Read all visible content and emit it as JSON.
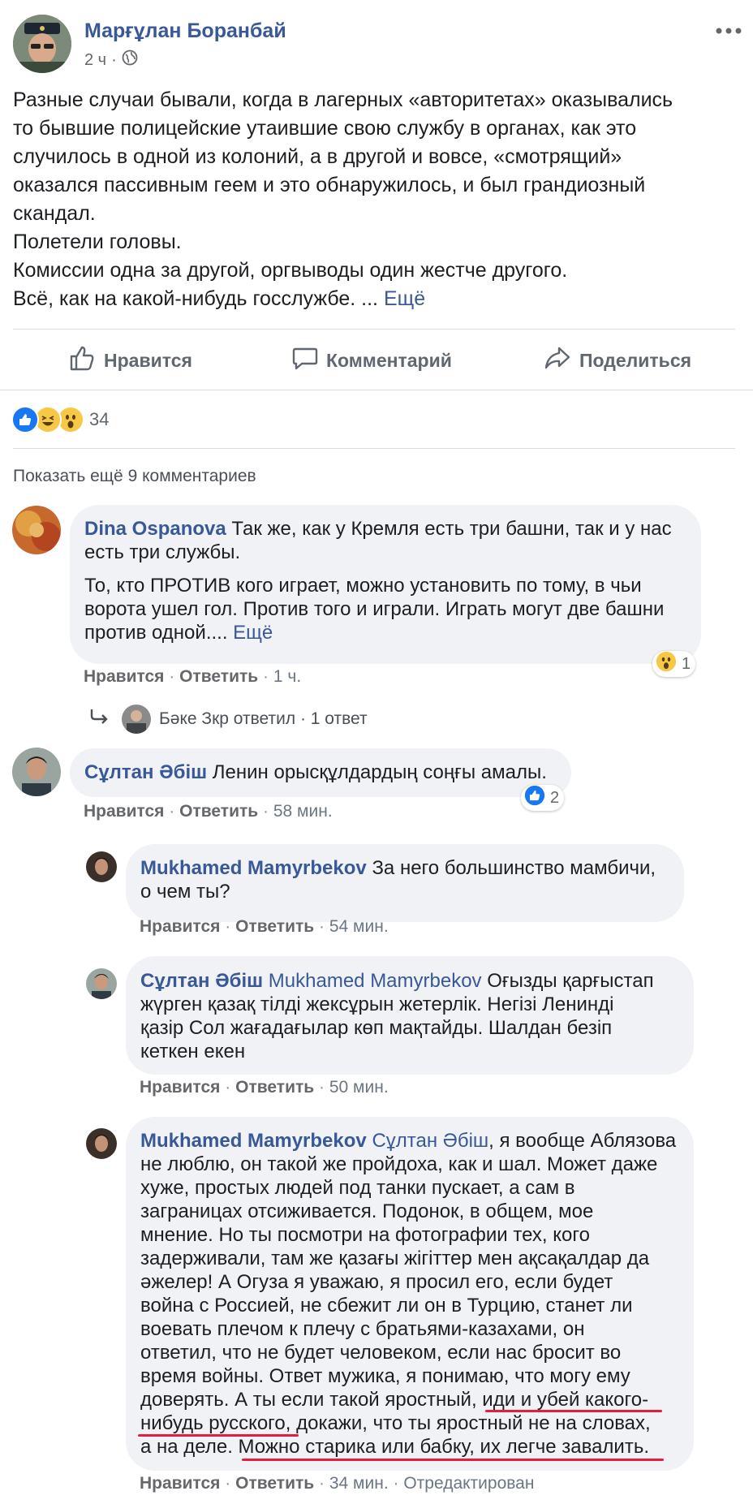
{
  "post": {
    "author": "Марғұлан Боранбай",
    "time": "2 ч",
    "more_icon": "more-dots-icon",
    "lines": [
      "Разные случаи бывали, когда в лагерных «авторитетах» оказывались",
      "то бывшие полицейские утаившие свою службу в органах, как это",
      "случилось в одной из колоний, а в другой и вовсе, «смотрящий»",
      "оказался пассивным геем и это обнаружилось, и был грандиозный",
      "скандал.",
      "Полетели головы.",
      "Комиссии одна за другой, оргвыводы один жестче другого.",
      "Всё, как на какой-нибудь госслужбе. ..."
    ],
    "see_more": "Ещё",
    "actions": {
      "like": "Нравится",
      "comment": "Комментарий",
      "share": "Поделиться"
    },
    "reactions_count": "34",
    "show_more_comments": "Показать ещё 9 комментариев"
  },
  "comments": {
    "c1": {
      "author": "Dina Ospanova",
      "line1": "Так же, как у Кремля есть три башни, так и у нас",
      "line2": "есть три службы.",
      "p2_lines": [
        "То, кто ПРОТИВ кого играет, можно установить по тому, в чьи",
        "ворота ушел гол. Против того и играли. Играть могут две башни",
        "против одной...."
      ],
      "see_more": "Ещё",
      "like": "Нравится",
      "reply": "Ответить",
      "time": "1 ч.",
      "reaction_count": "1",
      "replies_summary": "Бәке Зкр ответил · 1 ответ"
    },
    "c2": {
      "author": "Сұлтан Әбіш",
      "text": "Ленин орысқұлдардың соңғы амалы.",
      "like": "Нравится",
      "reply": "Ответить",
      "time": "58 мин.",
      "reaction_count": "2"
    },
    "r1": {
      "author": "Mukhamed Mamyrbekov",
      "line1": "За него большинство мамбичи,",
      "line2": "о чем ты?",
      "like": "Нравится",
      "reply": "Ответить",
      "time": "54 мин."
    },
    "r2": {
      "author": "Сұлтан Әбіш",
      "mention": "Mukhamed Mamyrbekov",
      "line1": "Оғызды қарғыстап",
      "lines": [
        "жүрген қазақ тілді жексұрын жетерлік. Негізі Ленинді",
        "қазір Сол жағадағылар көп мақтайды. Шалдан безіп",
        "кеткен екен"
      ],
      "like": "Нравится",
      "reply": "Ответить",
      "time": "50 мин."
    },
    "r3": {
      "author": "Mukhamed Mamyrbekov",
      "mention": "Сұлтан Әбіш",
      "line1": ", я вообще Аблязова",
      "lines": [
        "не люблю, он такой же пройдоха, как и шал. Может даже",
        "хуже, простых людей под танки пускает, а сам в",
        "заграницах отсиживается. Подонок, в общем, мое",
        "мнение. Но ты посмотри на фотографии тех, кого",
        "задерживали, там же қазағы жігіттер мен ақсақалдар да",
        "әжелер! А Огуза я уважаю, я просил его, если будет",
        "война с Россией, не сбежит ли он в Турцию, станет ли",
        "воевать плечом к плечу с братьями-казахами, он",
        "ответил, что не будет человеком, если нас бросит во",
        "время войны. Ответ мужика, я понимаю, что могу ему",
        "доверять. А ты если такой яростный, иди и убей какого-",
        "нибудь русского, докажи, что ты яростный не на словах,",
        "а на деле. Можно старика или бабку, их легче завалить."
      ],
      "like": "Нравится",
      "reply": "Ответить",
      "time": "34 мин.",
      "edited": "Отредактирован"
    }
  },
  "colors": {
    "link": "#385898",
    "bubble": "#f0f2f5",
    "underline": "#e41e3f",
    "meta": "#65676b"
  }
}
